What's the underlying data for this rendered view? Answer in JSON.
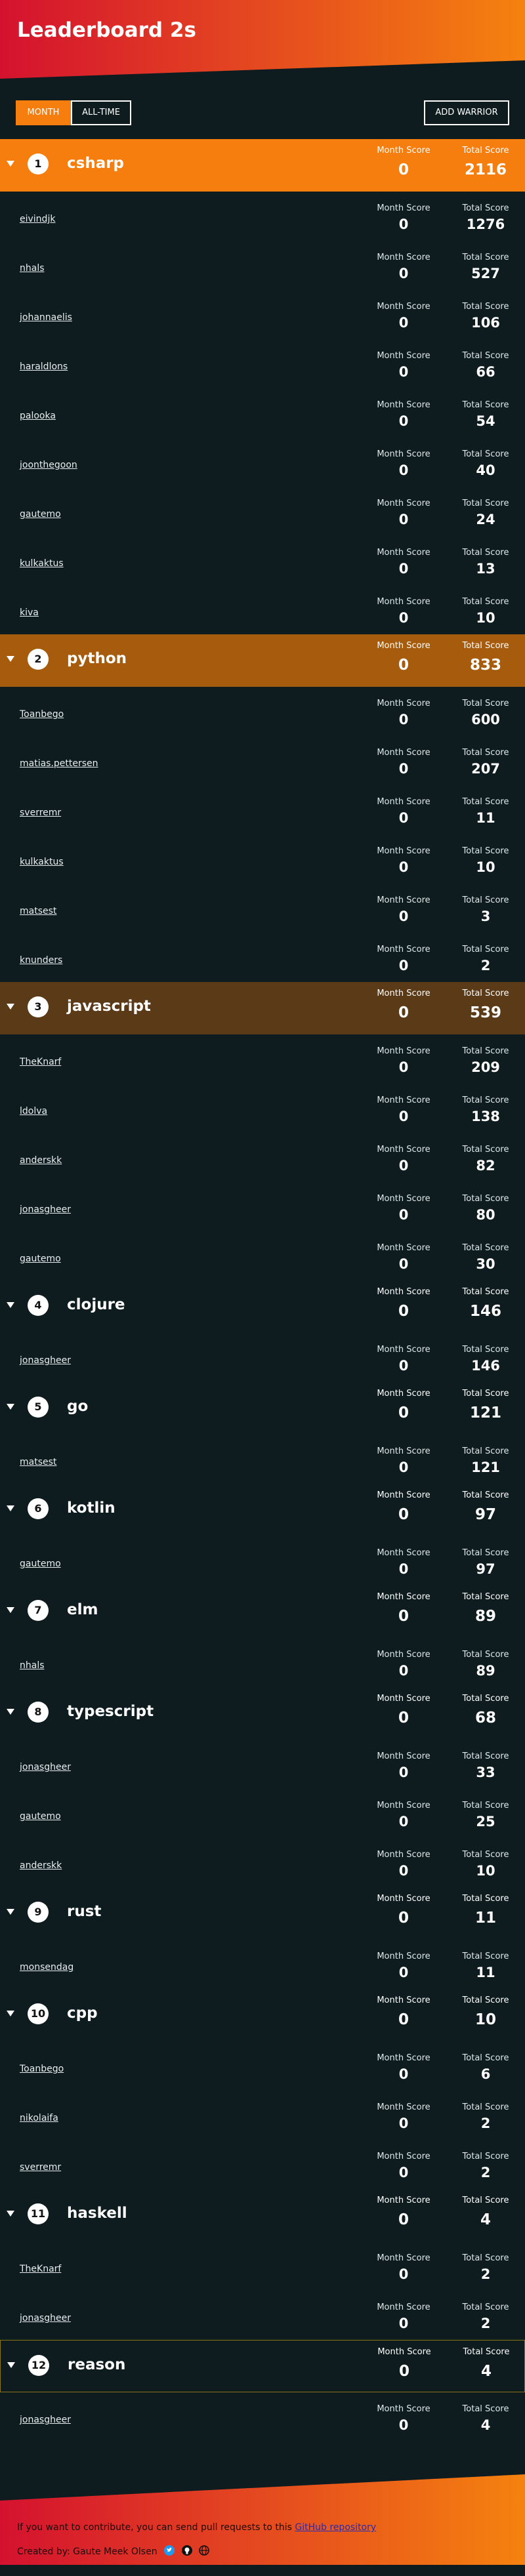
{
  "title": "Leaderboard 2s",
  "buttons": {
    "month": "MONTH",
    "all_time": "ALL-TIME",
    "add": "ADD WARRIOR"
  },
  "labels": {
    "month_score": "Month Score",
    "total_score": "Total Score"
  },
  "colors": {
    "1": "#f57e0f",
    "2": "#a65c0c",
    "3": "#5b3a18",
    "default": "#0e1c1f",
    "highlight_border": "#8c7418"
  },
  "groups": [
    {
      "rank": "1",
      "lang": "csharp",
      "month": "0",
      "total": "2116",
      "members": [
        {
          "name": "eivindjk",
          "month": "0",
          "total": "1276"
        },
        {
          "name": "nhals",
          "month": "0",
          "total": "527"
        },
        {
          "name": "johannaelis",
          "month": "0",
          "total": "106"
        },
        {
          "name": "haraldlons",
          "month": "0",
          "total": "66"
        },
        {
          "name": "palooka",
          "month": "0",
          "total": "54"
        },
        {
          "name": "joonthegoon",
          "month": "0",
          "total": "40"
        },
        {
          "name": "gautemo",
          "month": "0",
          "total": "24"
        },
        {
          "name": "kulkaktus",
          "month": "0",
          "total": "13"
        },
        {
          "name": "kiva",
          "month": "0",
          "total": "10"
        }
      ]
    },
    {
      "rank": "2",
      "lang": "python",
      "month": "0",
      "total": "833",
      "members": [
        {
          "name": "Toanbego",
          "month": "0",
          "total": "600"
        },
        {
          "name": "matias.pettersen",
          "month": "0",
          "total": "207"
        },
        {
          "name": "sverremr",
          "month": "0",
          "total": "11"
        },
        {
          "name": "kulkaktus",
          "month": "0",
          "total": "10"
        },
        {
          "name": "matsest",
          "month": "0",
          "total": "3"
        },
        {
          "name": "knunders",
          "month": "0",
          "total": "2"
        }
      ]
    },
    {
      "rank": "3",
      "lang": "javascript",
      "month": "0",
      "total": "539",
      "members": [
        {
          "name": "TheKnarf",
          "month": "0",
          "total": "209"
        },
        {
          "name": "ldolva",
          "month": "0",
          "total": "138"
        },
        {
          "name": "anderskk",
          "month": "0",
          "total": "82"
        },
        {
          "name": "jonasgheer",
          "month": "0",
          "total": "80"
        },
        {
          "name": "gautemo",
          "month": "0",
          "total": "30"
        }
      ]
    },
    {
      "rank": "4",
      "lang": "clojure",
      "month": "0",
      "total": "146",
      "members": [
        {
          "name": "jonasgheer",
          "month": "0",
          "total": "146"
        }
      ]
    },
    {
      "rank": "5",
      "lang": "go",
      "month": "0",
      "total": "121",
      "members": [
        {
          "name": "matsest",
          "month": "0",
          "total": "121"
        }
      ]
    },
    {
      "rank": "6",
      "lang": "kotlin",
      "month": "0",
      "total": "97",
      "members": [
        {
          "name": "gautemo",
          "month": "0",
          "total": "97"
        }
      ]
    },
    {
      "rank": "7",
      "lang": "elm",
      "month": "0",
      "total": "89",
      "members": [
        {
          "name": "nhals",
          "month": "0",
          "total": "89"
        }
      ]
    },
    {
      "rank": "8",
      "lang": "typescript",
      "month": "0",
      "total": "68",
      "members": [
        {
          "name": "jonasgheer",
          "month": "0",
          "total": "33"
        },
        {
          "name": "gautemo",
          "month": "0",
          "total": "25"
        },
        {
          "name": "anderskk",
          "month": "0",
          "total": "10"
        }
      ]
    },
    {
      "rank": "9",
      "lang": "rust",
      "month": "0",
      "total": "11",
      "members": [
        {
          "name": "monsendag",
          "month": "0",
          "total": "11"
        }
      ]
    },
    {
      "rank": "10",
      "lang": "cpp",
      "month": "0",
      "total": "10",
      "members": [
        {
          "name": "Toanbego",
          "month": "0",
          "total": "6"
        },
        {
          "name": "nikolaifa",
          "month": "0",
          "total": "2"
        },
        {
          "name": "sverremr",
          "month": "0",
          "total": "2"
        }
      ]
    },
    {
      "rank": "11",
      "lang": "haskell",
      "month": "0",
      "total": "4",
      "members": [
        {
          "name": "TheKnarf",
          "month": "0",
          "total": "2"
        },
        {
          "name": "jonasgheer",
          "month": "0",
          "total": "2"
        }
      ]
    },
    {
      "rank": "12",
      "lang": "reason",
      "month": "0",
      "total": "4",
      "highlight": true,
      "members": [
        {
          "name": "jonasgheer",
          "month": "0",
          "total": "4"
        }
      ]
    }
  ],
  "footer": {
    "contribute_prefix": "If you want to contribute, you can send pull requests to this ",
    "repo_link": "GitHub repository",
    "created_by": "Created by: Gaute Meek Olsen",
    "icons": [
      "twitter-icon",
      "github-icon",
      "globe-icon"
    ]
  }
}
